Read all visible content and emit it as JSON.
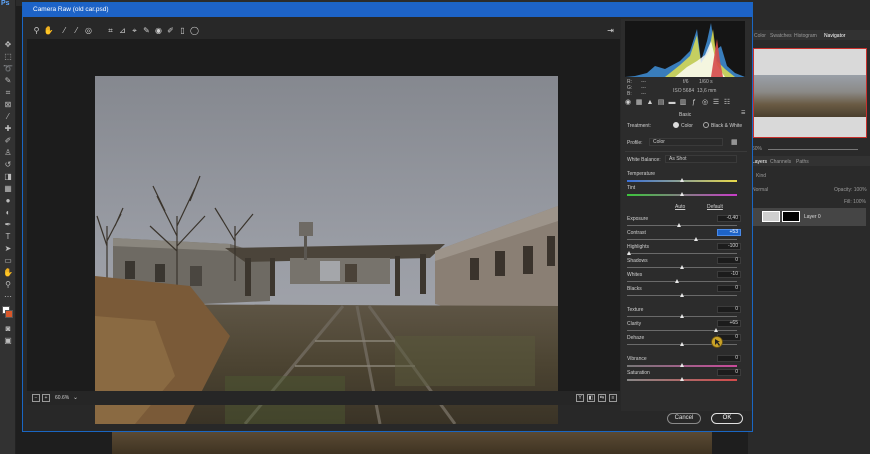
{
  "dialog": {
    "title": "Camera Raw (old car.psd)",
    "zoom": "60.6%",
    "cancel": "Cancel",
    "ok": "OK"
  },
  "readout": {
    "r_label": "R:",
    "g_label": "G:",
    "b_label": "B:",
    "r": "---",
    "g": "---",
    "b": "---",
    "aperture": "f/6",
    "shutter": "1/60 s",
    "iso": "ISO 5684",
    "focal": "13,6 mm"
  },
  "basic": {
    "section_title": "Basic",
    "treatment_label": "Treatment:",
    "color_option": "Color",
    "bw_option": "Black & White",
    "profile_label": "Profile:",
    "profile_value": "Color",
    "wb_label": "White Balance:",
    "wb_value": "As Shot",
    "auto": "Auto",
    "default": "Default",
    "sliders": [
      {
        "label": "Temperature",
        "value": "",
        "pos": 0.5
      },
      {
        "label": "Tint",
        "value": "",
        "pos": 0.5
      },
      {
        "label": "Exposure",
        "value": "-0,40",
        "pos": 0.47
      },
      {
        "label": "Contrast",
        "value": "+53",
        "pos": 0.63
      },
      {
        "label": "Highlights",
        "value": "-100",
        "pos": 0.0
      },
      {
        "label": "Shadows",
        "value": "0",
        "pos": 0.5
      },
      {
        "label": "Whites",
        "value": "-10",
        "pos": 0.45
      },
      {
        "label": "Blacks",
        "value": "0",
        "pos": 0.5
      },
      {
        "label": "Texture",
        "value": "0",
        "pos": 0.5
      },
      {
        "label": "Clarity",
        "value": "+65",
        "pos": 0.82
      },
      {
        "label": "Dehaze",
        "value": "0",
        "pos": 0.5
      },
      {
        "label": "Vibrance",
        "value": "0",
        "pos": 0.5
      },
      {
        "label": "Saturation",
        "value": "0",
        "pos": 0.5
      }
    ]
  },
  "ps": {
    "tabs": [
      "Color",
      "Swatches",
      "Histogram",
      "Navigator"
    ],
    "zoom": "60%",
    "layer_tabs": [
      "Layers",
      "Channels",
      "Paths"
    ],
    "kind": "Kind",
    "blend": "Normal",
    "opacity": "Opacity: 100%",
    "fill": "Fill: 100%",
    "layer_name": "Layer 0"
  },
  "colors": {
    "accent": "#1d63c7",
    "dialog_bg": "#282828",
    "foreground_swatch": "#d8572a"
  }
}
